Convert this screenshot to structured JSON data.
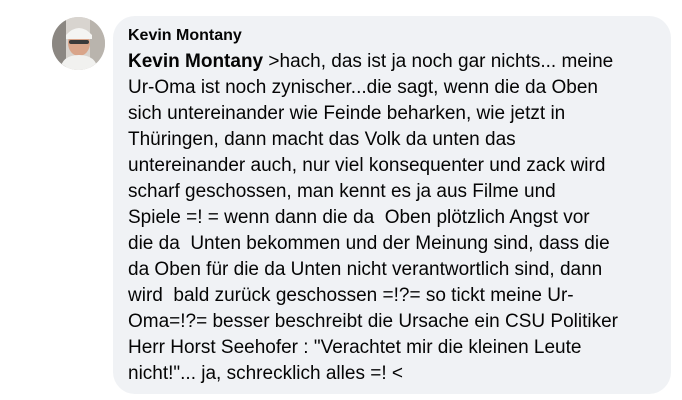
{
  "comment": {
    "author_name": "Kevin Montany",
    "mention": "Kevin Montany",
    "lines": [
      " >hach, das ist ja noch gar nichts... meine",
      "Ur-Oma ist noch zynischer...die sagt, wenn die da Oben",
      "sich untereinander wie Feinde beharken, wie jetzt in",
      "Thüringen, dann macht das Volk da unten das",
      "untereinander auch, nur viel konsequenter und zack wird",
      "scharf geschossen, man kennt es ja aus Filme und",
      "Spiele =! = wenn dann die da  Oben plötzlich Angst vor",
      "die da  Unten bekommen und der Meinung sind, dass die",
      "da Oben für die da Unten nicht verantwortlich sind, dann",
      "wird  bald zurück geschossen =!?= so tickt meine Ur-",
      "Oma=!?= besser beschreibt die Ursache ein CSU Politiker",
      "Herr Horst Seehofer : \"Verachtet mir die kleinen Leute",
      "nicht!\"... ja, schrecklich alles =! <"
    ]
  },
  "colors": {
    "bubble_background": "#f0f2f5",
    "text": "#050505"
  },
  "icons": {
    "avatar": "profile-photo"
  }
}
